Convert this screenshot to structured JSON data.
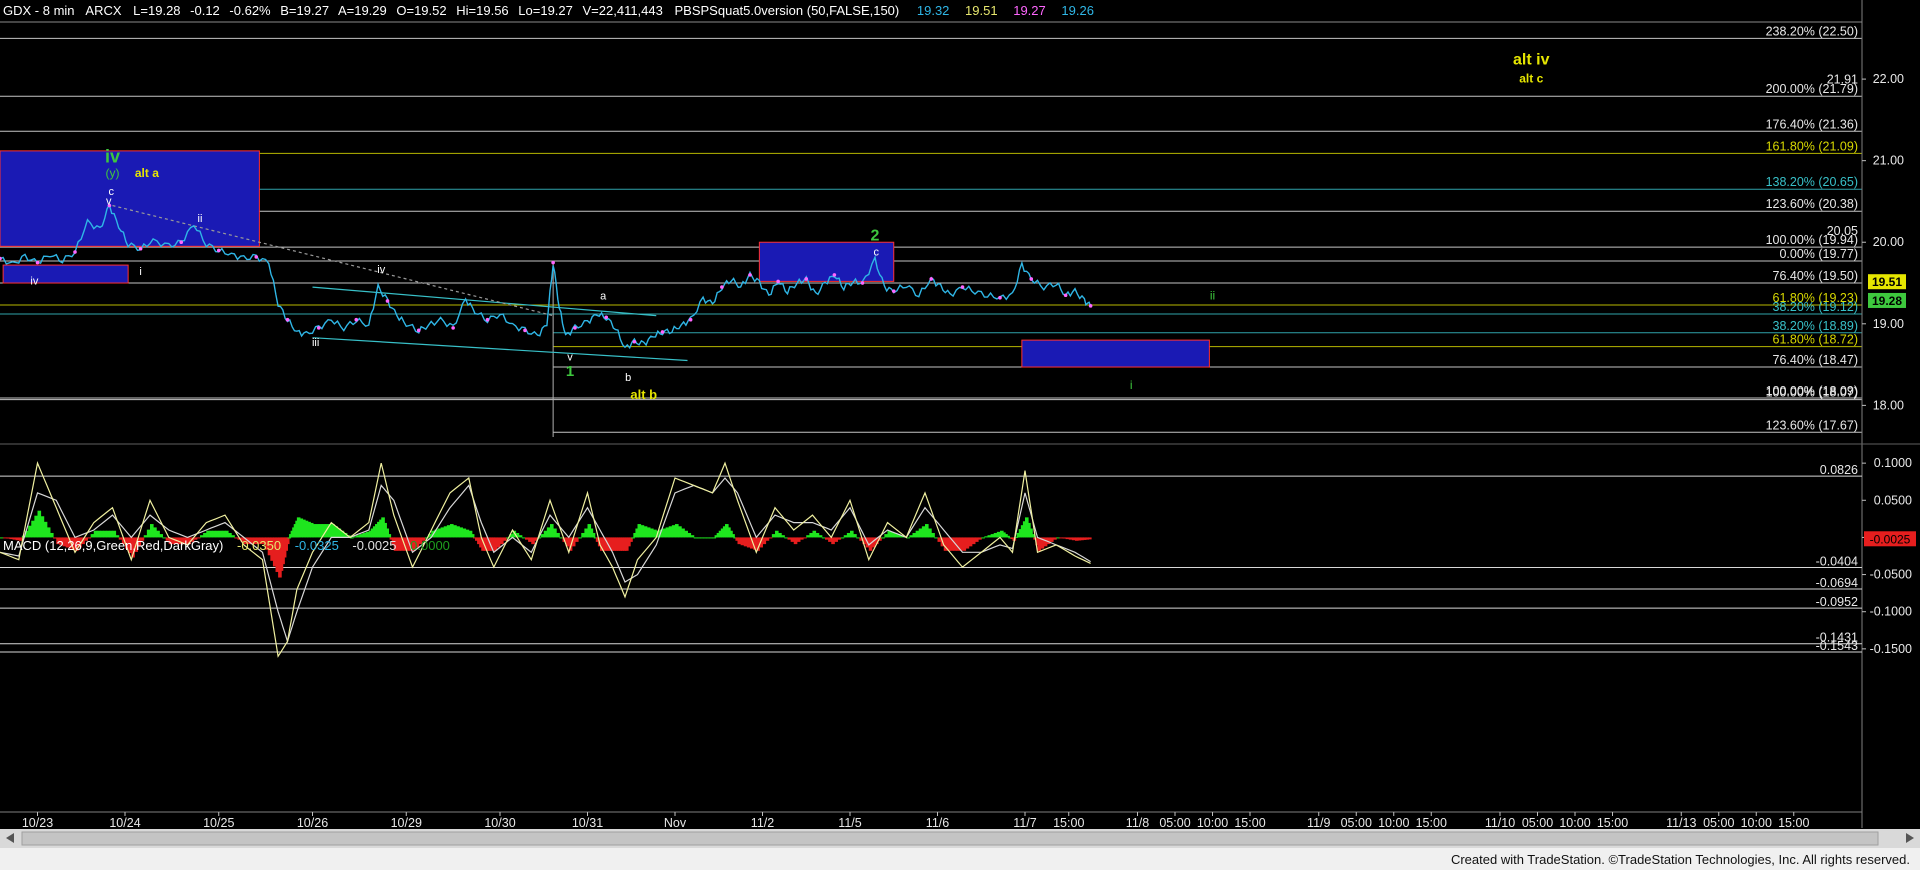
{
  "header": {
    "symbol": "GDX - 8 min",
    "exchange": "ARCX",
    "last": "L=19.28",
    "change": "-0.12",
    "change_pct": "-0.62%",
    "bid": "B=19.27",
    "ask": "A=19.29",
    "open": "O=19.52",
    "high": "Hi=19.56",
    "low": "Lo=19.27",
    "volume": "V=22,411,443",
    "study": "PBSPSquat5.0version (50,FALSE,150)",
    "study_values": [
      "19.32",
      "19.51",
      "19.27",
      "19.26"
    ],
    "study_colors": [
      "#2fb6e6",
      "#e6e66e",
      "#ff66ff",
      "#2fb6e6"
    ]
  },
  "macd_header": {
    "label": "MACD (12,26,9,Green,Red,DarkGray)",
    "values": [
      "-0.0350",
      "-0.0325",
      "-0.0025",
      "0.0000"
    ],
    "colors": [
      "#e6e66e",
      "#2fb6e6",
      "#e0e0e0",
      "#1e9e1e"
    ]
  },
  "colors": {
    "price": "#2fb6e6",
    "price_marker": "#ff66ff",
    "wave_green": "#3ec83e",
    "wave_yellow": "#e6e600",
    "wave_white": "#ffffff",
    "fib_white": "#e8e8e8",
    "fib_cyan": "#38c0c8",
    "fib_yellow": "#d8d800",
    "box_fill": "#1a1ab4",
    "box_border": "#ff3030",
    "macd_pos": "#1ee61e",
    "macd_neg": "#e61e1e",
    "macd_line": "#f0f0a0",
    "macd_signal": "#d8d8d8"
  },
  "chart_data": {
    "type": "line",
    "title": "GDX - 8 min",
    "price_axis": {
      "range": [
        17.6,
        22.7
      ],
      "ticks": [
        "18.00",
        "19.00",
        "20.00",
        "21.00",
        "22.00"
      ]
    },
    "macd_axis": {
      "range": [
        -0.165,
        0.115
      ],
      "ticks": [
        "0.1000",
        "0.0500",
        "0.0000",
        "-0.0500",
        "-0.1000",
        "-0.1500"
      ]
    },
    "time_axis": {
      "range": [
        0,
        30
      ],
      "labels": [
        {
          "x": 0.6,
          "text": "10/23"
        },
        {
          "x": 2.0,
          "text": "10/24"
        },
        {
          "x": 3.5,
          "text": "10/25"
        },
        {
          "x": 5.0,
          "text": "10/26"
        },
        {
          "x": 6.5,
          "text": "10/29"
        },
        {
          "x": 8.0,
          "text": "10/30"
        },
        {
          "x": 9.4,
          "text": "10/31"
        },
        {
          "x": 10.8,
          "text": "Nov"
        },
        {
          "x": 12.2,
          "text": "11/2"
        },
        {
          "x": 13.6,
          "text": "11/5"
        },
        {
          "x": 15.0,
          "text": "11/6"
        },
        {
          "x": 16.4,
          "text": "11/7"
        },
        {
          "x": 17.1,
          "text": "15:00"
        },
        {
          "x": 18.2,
          "text": "11/8"
        },
        {
          "x": 18.8,
          "text": "05:00"
        },
        {
          "x": 19.4,
          "text": "10:00"
        },
        {
          "x": 20.0,
          "text": "15:00"
        },
        {
          "x": 21.1,
          "text": "11/9"
        },
        {
          "x": 21.7,
          "text": "05:00"
        },
        {
          "x": 22.3,
          "text": "10:00"
        },
        {
          "x": 22.9,
          "text": "15:00"
        },
        {
          "x": 24.0,
          "text": "11/10"
        },
        {
          "x": 24.6,
          "text": "05:00"
        },
        {
          "x": 25.2,
          "text": "10:00"
        },
        {
          "x": 25.8,
          "text": "15:00"
        },
        {
          "x": 26.9,
          "text": "11/13"
        },
        {
          "x": 27.5,
          "text": "05:00"
        },
        {
          "x": 28.1,
          "text": "10:00"
        },
        {
          "x": 28.7,
          "text": "15:00"
        }
      ]
    },
    "fib_levels": [
      {
        "label": "238.20% (22.50)",
        "value": 22.5,
        "color": "white",
        "x0": 0
      },
      {
        "label": "200.00% (21.79)",
        "value": 21.79,
        "color": "white",
        "x0": 0
      },
      {
        "label": "176.40% (21.36)",
        "value": 21.36,
        "color": "white",
        "x0": 0
      },
      {
        "label": "161.80% (21.09)",
        "value": 21.09,
        "color": "yellow",
        "x0": 0
      },
      {
        "label": "138.20% (20.65)",
        "value": 20.65,
        "color": "cyan",
        "x0": 0
      },
      {
        "label": "123.60% (20.38)",
        "value": 20.38,
        "color": "white",
        "x0": 0
      },
      {
        "label": "100.00% (19.94)",
        "value": 19.94,
        "color": "white",
        "x0": 0
      },
      {
        "label": "0.00% (19.77)",
        "value": 19.77,
        "color": "white",
        "x0": 0
      },
      {
        "label": "76.40% (19.50)",
        "value": 19.5,
        "color": "white",
        "x0": 0
      },
      {
        "label": "61.80% (19.23)",
        "value": 19.23,
        "color": "yellow",
        "x0": 0
      },
      {
        "label": "38.20% (19.12)",
        "value": 19.12,
        "color": "cyan",
        "x0": 0
      },
      {
        "label": "38.20% (18.89)",
        "value": 18.89,
        "color": "cyan",
        "x0": 8.85
      },
      {
        "label": "61.80% (18.72)",
        "value": 18.72,
        "color": "yellow",
        "x0": 8.85
      },
      {
        "label": "76.40% (18.47)",
        "value": 18.47,
        "color": "white",
        "x0": 8.85
      },
      {
        "label": "100.00% (18.09)",
        "value": 18.09,
        "color": "white",
        "x0": 0
      },
      {
        "label": "100.00% (18.07)",
        "value": 18.07,
        "color": "white",
        "x0": 0
      },
      {
        "label": "123.60% (17.67)",
        "value": 17.67,
        "color": "white",
        "x0": 8.85
      }
    ],
    "price_labels": [
      {
        "text": "21.91",
        "value": 21.91
      },
      {
        "text": "20.05",
        "value": 20.05
      }
    ],
    "price_tags": [
      {
        "text": "19.51",
        "value": 19.51,
        "bg": "#e6e600"
      },
      {
        "text": "19.28",
        "value": 19.28,
        "bg": "#3ec83e"
      }
    ],
    "macd_levels": [
      {
        "label": "0.0826",
        "value": 0.0826
      },
      {
        "label": "-0.0404",
        "value": -0.0404
      },
      {
        "label": "-0.0694",
        "value": -0.0694
      },
      {
        "label": "-0.0952",
        "value": -0.0952
      },
      {
        "label": "-0.1431",
        "value": -0.1431
      },
      {
        "label": "-0.1543",
        "value": -0.1543
      }
    ],
    "macd_tag": {
      "text": "-0.0025",
      "value": -0.0025
    },
    "boxes": [
      {
        "x0": 0.0,
        "x1": 4.15,
        "y0": 19.95,
        "y1": 21.12
      },
      {
        "x0": 0.05,
        "x1": 2.05,
        "y0": 19.5,
        "y1": 19.72
      },
      {
        "x0": 12.15,
        "x1": 14.3,
        "y0": 19.52,
        "y1": 20.0
      },
      {
        "x0": 16.35,
        "x1": 19.35,
        "y0": 18.47,
        "y1": 18.8
      }
    ],
    "price_series": [
      [
        0.0,
        19.8
      ],
      [
        0.2,
        19.73
      ],
      [
        0.4,
        19.82
      ],
      [
        0.6,
        19.75
      ],
      [
        0.8,
        19.85
      ],
      [
        1.0,
        19.78
      ],
      [
        1.2,
        19.88
      ],
      [
        1.4,
        20.25
      ],
      [
        1.6,
        20.15
      ],
      [
        1.75,
        20.45
      ],
      [
        1.9,
        20.2
      ],
      [
        2.05,
        19.98
      ],
      [
        2.25,
        19.92
      ],
      [
        2.45,
        20.02
      ],
      [
        2.7,
        19.95
      ],
      [
        2.9,
        20.0
      ],
      [
        3.1,
        20.22
      ],
      [
        3.3,
        19.98
      ],
      [
        3.5,
        19.9
      ],
      [
        3.7,
        19.85
      ],
      [
        3.9,
        19.8
      ],
      [
        4.1,
        19.82
      ],
      [
        4.3,
        19.75
      ],
      [
        4.45,
        19.25
      ],
      [
        4.6,
        19.05
      ],
      [
        4.75,
        18.9
      ],
      [
        4.9,
        18.87
      ],
      [
        5.1,
        18.95
      ],
      [
        5.3,
        19.05
      ],
      [
        5.5,
        18.95
      ],
      [
        5.7,
        19.05
      ],
      [
        5.9,
        18.98
      ],
      [
        6.05,
        19.45
      ],
      [
        6.2,
        19.28
      ],
      [
        6.35,
        19.1
      ],
      [
        6.5,
        19.0
      ],
      [
        6.7,
        18.92
      ],
      [
        6.85,
        18.98
      ],
      [
        7.05,
        19.05
      ],
      [
        7.25,
        18.95
      ],
      [
        7.45,
        19.3
      ],
      [
        7.6,
        19.15
      ],
      [
        7.8,
        19.05
      ],
      [
        8.0,
        19.12
      ],
      [
        8.2,
        18.98
      ],
      [
        8.4,
        18.92
      ],
      [
        8.6,
        18.85
      ],
      [
        8.75,
        19.0
      ],
      [
        8.85,
        19.75
      ],
      [
        8.95,
        19.2
      ],
      [
        9.05,
        18.85
      ],
      [
        9.2,
        18.95
      ],
      [
        9.4,
        19.02
      ],
      [
        9.55,
        19.12
      ],
      [
        9.7,
        19.08
      ],
      [
        9.85,
        18.95
      ],
      [
        10.0,
        18.7
      ],
      [
        10.15,
        18.78
      ],
      [
        10.3,
        18.75
      ],
      [
        10.45,
        18.85
      ],
      [
        10.6,
        18.9
      ],
      [
        10.75,
        18.92
      ],
      [
        10.9,
        18.98
      ],
      [
        11.05,
        19.05
      ],
      [
        11.25,
        19.3
      ],
      [
        11.4,
        19.25
      ],
      [
        11.55,
        19.45
      ],
      [
        11.7,
        19.55
      ],
      [
        11.85,
        19.45
      ],
      [
        12.0,
        19.6
      ],
      [
        12.15,
        19.5
      ],
      [
        12.3,
        19.35
      ],
      [
        12.45,
        19.52
      ],
      [
        12.6,
        19.4
      ],
      [
        12.75,
        19.5
      ],
      [
        12.9,
        19.55
      ],
      [
        13.05,
        19.35
      ],
      [
        13.2,
        19.5
      ],
      [
        13.35,
        19.6
      ],
      [
        13.5,
        19.45
      ],
      [
        13.65,
        19.52
      ],
      [
        13.8,
        19.5
      ],
      [
        14.0,
        19.78
      ],
      [
        14.15,
        19.45
      ],
      [
        14.3,
        19.4
      ],
      [
        14.5,
        19.48
      ],
      [
        14.7,
        19.35
      ],
      [
        14.9,
        19.55
      ],
      [
        15.05,
        19.45
      ],
      [
        15.2,
        19.35
      ],
      [
        15.4,
        19.45
      ],
      [
        15.6,
        19.4
      ],
      [
        15.8,
        19.35
      ],
      [
        16.0,
        19.32
      ],
      [
        16.2,
        19.35
      ],
      [
        16.35,
        19.72
      ],
      [
        16.5,
        19.55
      ],
      [
        16.7,
        19.45
      ],
      [
        16.9,
        19.5
      ],
      [
        17.05,
        19.35
      ],
      [
        17.2,
        19.4
      ],
      [
        17.35,
        19.28
      ],
      [
        17.45,
        19.22
      ]
    ],
    "wave_labels": [
      {
        "x": 1.8,
        "y": 20.98,
        "text": "iv",
        "color": "green",
        "size": 18,
        "bold": true
      },
      {
        "x": 1.8,
        "y": 20.8,
        "text": "(y)",
        "color": "green",
        "size": 12,
        "bold": false
      },
      {
        "x": 2.35,
        "y": 20.8,
        "text": "alt a",
        "color": "yellow",
        "size": 12,
        "bold": true
      },
      {
        "x": 1.78,
        "y": 20.58,
        "text": "c",
        "color": "white",
        "size": 11,
        "bold": false
      },
      {
        "x": 1.74,
        "y": 20.46,
        "text": "v",
        "color": "white",
        "size": 11,
        "bold": false
      },
      {
        "x": 3.2,
        "y": 20.25,
        "text": "ii",
        "color": "white",
        "size": 11,
        "bold": false
      },
      {
        "x": 2.25,
        "y": 19.6,
        "text": "i",
        "color": "white",
        "size": 11,
        "bold": false
      },
      {
        "x": 0.55,
        "y": 19.48,
        "text": "iv",
        "color": "white",
        "size": 11,
        "bold": false
      },
      {
        "x": 6.1,
        "y": 19.62,
        "text": "iv",
        "color": "white",
        "size": 11,
        "bold": false
      },
      {
        "x": 5.05,
        "y": 18.73,
        "text": "iii",
        "color": "white",
        "size": 11,
        "bold": false
      },
      {
        "x": 9.12,
        "y": 18.55,
        "text": "v",
        "color": "white",
        "size": 11,
        "bold": false
      },
      {
        "x": 9.12,
        "y": 18.36,
        "text": "1",
        "color": "green",
        "size": 15,
        "bold": true
      },
      {
        "x": 9.65,
        "y": 19.3,
        "text": "a",
        "color": "white",
        "size": 11,
        "bold": false
      },
      {
        "x": 10.05,
        "y": 18.3,
        "text": "b",
        "color": "white",
        "size": 11,
        "bold": false
      },
      {
        "x": 10.3,
        "y": 18.08,
        "text": "alt b",
        "color": "yellow",
        "size": 13,
        "bold": true
      },
      {
        "x": 14.0,
        "y": 20.02,
        "text": "2",
        "color": "green",
        "size": 16,
        "bold": true
      },
      {
        "x": 14.02,
        "y": 19.84,
        "text": "c",
        "color": "white",
        "size": 11,
        "bold": false
      },
      {
        "x": 19.4,
        "y": 19.3,
        "text": "ii",
        "color": "green",
        "size": 12,
        "bold": false
      },
      {
        "x": 18.1,
        "y": 18.2,
        "text": "i",
        "color": "green",
        "size": 12,
        "bold": false
      },
      {
        "x": 24.5,
        "y": 22.18,
        "text": "alt iv",
        "color": "yellow",
        "size": 16,
        "bold": true
      },
      {
        "x": 24.5,
        "y": 21.96,
        "text": "alt c",
        "color": "yellow",
        "size": 12,
        "bold": true
      }
    ],
    "trend_lines": [
      {
        "x0": 5.0,
        "y0": 19.45,
        "x1": 10.5,
        "y1": 19.1,
        "color": "cyan"
      },
      {
        "x0": 5.0,
        "y0": 18.83,
        "x1": 11.0,
        "y1": 18.55,
        "color": "cyan"
      },
      {
        "x0": 1.8,
        "y0": 20.45,
        "x1": 8.85,
        "y1": 19.1,
        "color": "gray_dashed"
      }
    ],
    "macd_series": {
      "x": [
        0.0,
        0.3,
        0.6,
        0.9,
        1.2,
        1.5,
        1.8,
        2.1,
        2.4,
        2.7,
        3.0,
        3.3,
        3.6,
        3.9,
        4.2,
        4.45,
        4.6,
        4.75,
        5.0,
        5.3,
        5.6,
        5.9,
        6.1,
        6.3,
        6.6,
        6.9,
        7.2,
        7.5,
        7.7,
        7.9,
        8.2,
        8.5,
        8.8,
        9.1,
        9.4,
        9.6,
        9.8,
        10.0,
        10.2,
        10.5,
        10.8,
        11.1,
        11.4,
        11.6,
        11.8,
        12.1,
        12.4,
        12.7,
        13.0,
        13.3,
        13.6,
        13.9,
        14.2,
        14.5,
        14.8,
        15.1,
        15.4,
        15.7,
        16.0,
        16.2,
        16.4,
        16.6,
        16.9,
        17.2,
        17.45
      ],
      "macd": [
        -0.02,
        -0.03,
        0.1,
        0.04,
        -0.02,
        0.02,
        0.04,
        -0.03,
        0.05,
        0.0,
        -0.01,
        0.02,
        0.03,
        -0.01,
        -0.03,
        -0.16,
        -0.14,
        -0.07,
        -0.02,
        0.02,
        0.0,
        0.02,
        0.1,
        0.03,
        -0.04,
        0.01,
        0.06,
        0.08,
        0.0,
        -0.04,
        0.01,
        -0.03,
        0.05,
        -0.02,
        0.06,
        -0.01,
        -0.04,
        -0.08,
        -0.03,
        0.0,
        0.08,
        0.07,
        0.06,
        0.1,
        0.05,
        -0.02,
        0.04,
        0.01,
        0.03,
        0.0,
        0.05,
        -0.03,
        0.02,
        0.0,
        0.06,
        -0.01,
        -0.04,
        -0.02,
        0.0,
        -0.02,
        0.09,
        -0.02,
        -0.01,
        -0.025,
        -0.035
      ],
      "signal": [
        -0.02,
        -0.025,
        0.06,
        0.05,
        0.0,
        0.01,
        0.03,
        0.0,
        0.03,
        0.01,
        0.0,
        0.01,
        0.02,
        0.0,
        -0.02,
        -0.1,
        -0.14,
        -0.1,
        -0.04,
        0.0,
        0.0,
        0.01,
        0.07,
        0.05,
        -0.02,
        0.0,
        0.04,
        0.07,
        0.02,
        -0.02,
        0.0,
        -0.02,
        0.03,
        0.0,
        0.04,
        0.01,
        -0.02,
        -0.06,
        -0.05,
        -0.01,
        0.06,
        0.07,
        0.06,
        0.08,
        0.06,
        0.0,
        0.03,
        0.02,
        0.02,
        0.01,
        0.04,
        -0.01,
        0.01,
        0.0,
        0.04,
        0.01,
        -0.02,
        -0.02,
        -0.01,
        -0.015,
        0.06,
        0.0,
        -0.01,
        -0.02,
        -0.0325
      ]
    }
  },
  "footer": {
    "credit": "Created with TradeStation. ©TradeStation Technologies, Inc. All rights reserved."
  }
}
